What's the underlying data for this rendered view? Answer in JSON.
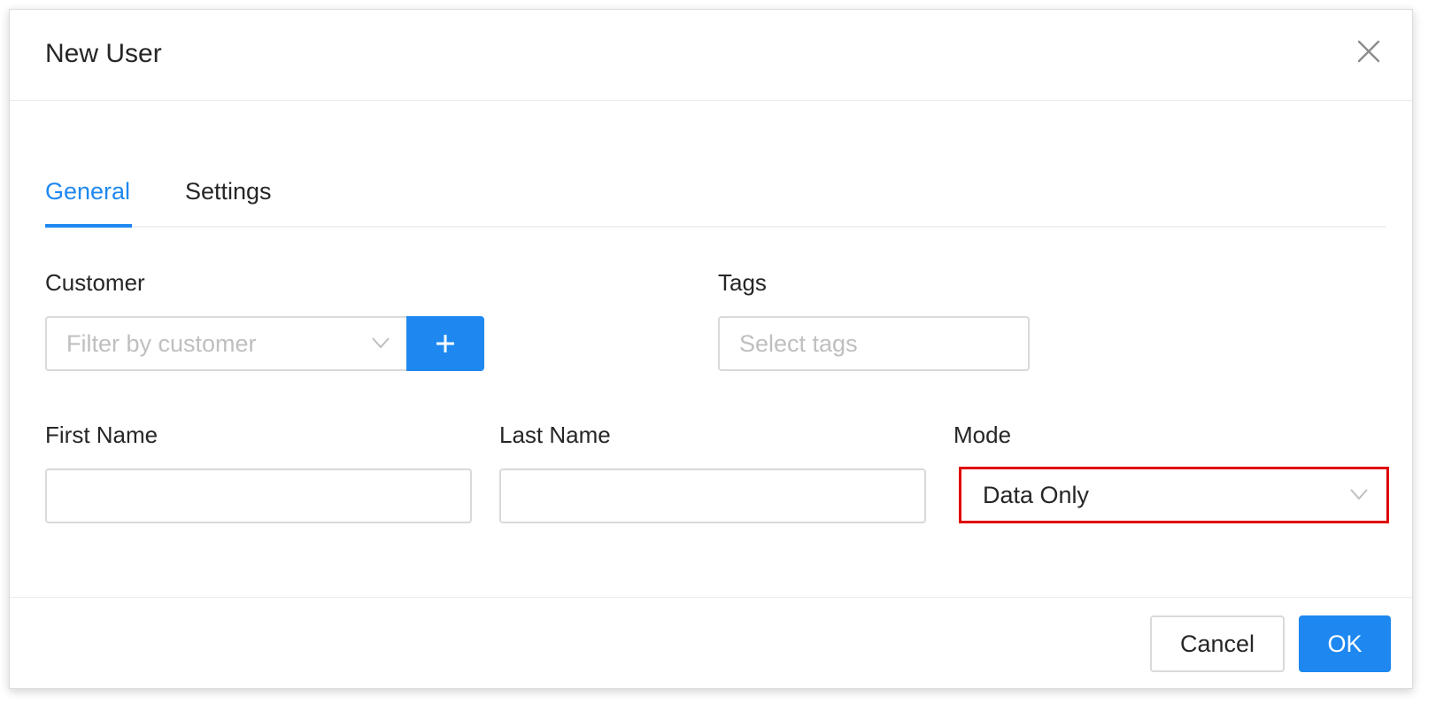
{
  "dialog": {
    "title": "New User"
  },
  "tabs": [
    {
      "label": "General",
      "active": true
    },
    {
      "label": "Settings",
      "active": false
    }
  ],
  "form": {
    "customer": {
      "label": "Customer",
      "placeholder": "Filter by customer",
      "add_icon": "plus-icon"
    },
    "tags": {
      "label": "Tags",
      "placeholder": "Select tags"
    },
    "first_name": {
      "label": "First Name",
      "value": ""
    },
    "last_name": {
      "label": "Last Name",
      "value": ""
    },
    "mode": {
      "label": "Mode",
      "value": "Data Only",
      "highlight_color": "#e00000"
    }
  },
  "footer": {
    "cancel_label": "Cancel",
    "ok_label": "OK"
  },
  "colors": {
    "primary": "#1e88f0",
    "text": "#262626",
    "placeholder": "#bfbfbf",
    "border": "#d9d9d9"
  }
}
